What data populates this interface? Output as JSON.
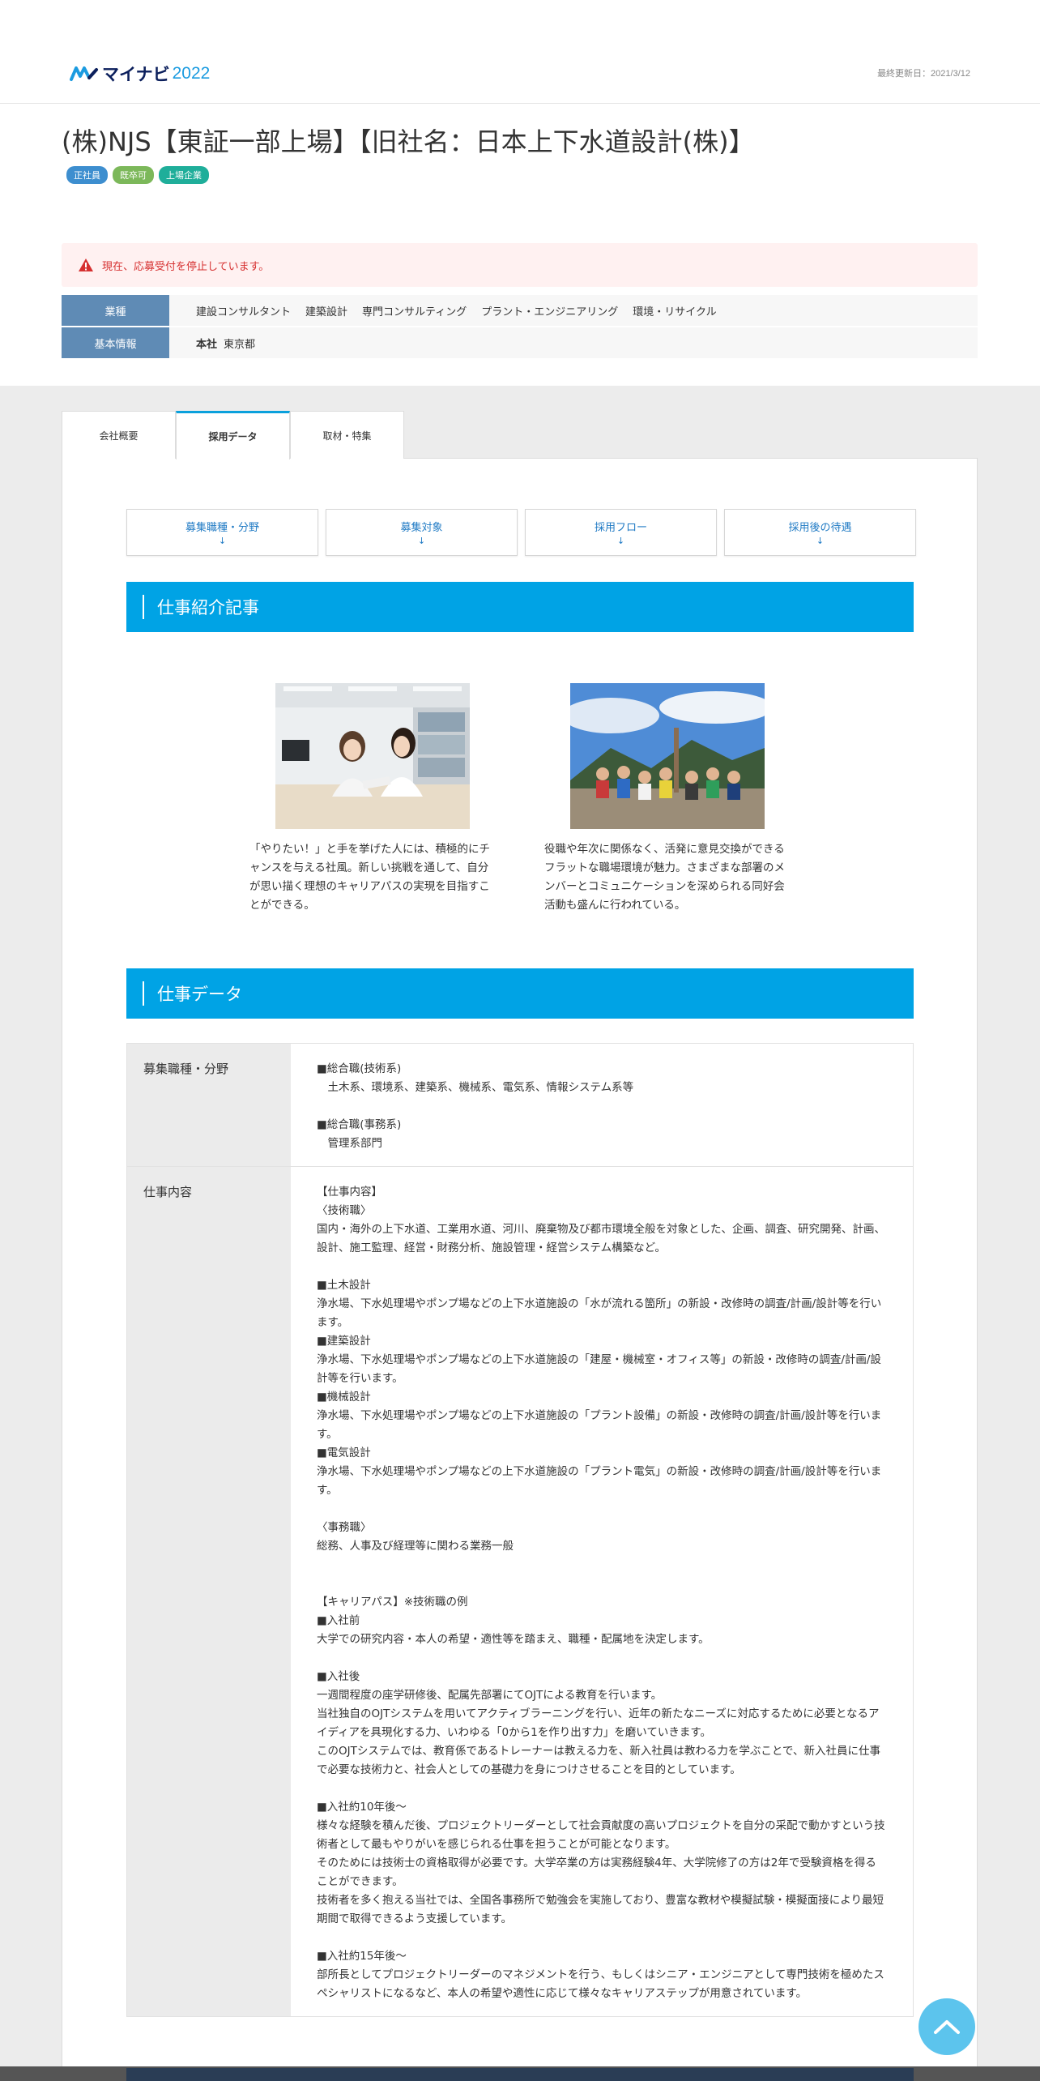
{
  "header": {
    "logo_text": "マイナビ",
    "logo_year": "2022",
    "updated": "最終更新日：2021/3/12"
  },
  "company": {
    "name": "(株)NJS【東証一部上場】【旧社名：日本上下水道設計(株)】",
    "tags": [
      {
        "label": "正社員",
        "color": "#3d8ecf"
      },
      {
        "label": "既卒可",
        "color": "#7cb85a"
      },
      {
        "label": "上場企業",
        "color": "#1fae9a"
      }
    ]
  },
  "notice": {
    "text": "現在、応募受付を停止しています。"
  },
  "info": {
    "industry_label": "業種",
    "industries": [
      "建設コンサルタント",
      "建築設計",
      "専門コンサルティング",
      "プラント・エンジニアリング",
      "環境・リサイクル"
    ],
    "basic_label": "基本情報",
    "hq_label": "本社",
    "hq_value": "東京都"
  },
  "tabs": [
    {
      "label": "会社概要"
    },
    {
      "label": "採用データ"
    },
    {
      "label": "取材・特集"
    }
  ],
  "jump_links": [
    {
      "label": "募集職種・分野",
      "arrow": "↓"
    },
    {
      "label": "募集対象",
      "arrow": "↓"
    },
    {
      "label": "採用フロー",
      "arrow": "↓"
    },
    {
      "label": "採用後の待遇",
      "arrow": "↓"
    }
  ],
  "sections": {
    "articles_title": "仕事紹介記事",
    "jobdata_title": "仕事データ"
  },
  "articles": [
    {
      "caption": "「やりたい！」と手を挙げた人には、積極的にチャンスを与える社風。新しい挑戦を通して、自分が思い描く理想のキャリアパスの実現を目指すことができる。"
    },
    {
      "caption": "役職や年次に関係なく、活発に意見交換ができるフラットな職場環境が魅力。さまざまな部署のメンバーとコミュニケーションを深められる同好会活動も盛んに行われている。"
    }
  ],
  "job_table": {
    "row1_head": "募集職種・分野",
    "row1_body": "■総合職(技術系)\n　土木系、環境系、建築系、機械系、電気系、情報システム系等\n\n■総合職(事務系)\n　管理系部門",
    "row2_head": "仕事内容",
    "row2_body": "【仕事内容】\n〈技術職〉\n国内・海外の上下水道、工業用水道、河川、廃棄物及び都市環境全般を対象とした、企画、調査、研究開発、計画、設計、施工監理、経営・財務分析、施設管理・経営システム構築など。\n\n■土木設計\n浄水場、下水処理場やポンプ場などの上下水道施設の「水が流れる箇所」の新設・改修時の調査/計画/設計等を行います。\n■建築設計\n浄水場、下水処理場やポンプ場などの上下水道施設の「建屋・機械室・オフィス等」の新設・改修時の調査/計画/設計等を行います。\n■機械設計\n浄水場、下水処理場やポンプ場などの上下水道施設の「プラント設備」の新設・改修時の調査/計画/設計等を行います。\n■電気設計\n浄水場、下水処理場やポンプ場などの上下水道施設の「プラント電気」の新設・改修時の調査/計画/設計等を行います。\n\n〈事務職〉\n総務、人事及び経理等に関わる業務一般\n\n\n【キャリアパス】※技術職の例\n■入社前\n大学での研究内容・本人の希望・適性等を踏まえ、職種・配属地を決定します。\n\n■入社後\n一週間程度の座学研修後、配属先部署にてOJTによる教育を行います。\n当社独自のOJTシステムを用いてアクティブラーニングを行い、近年の新たなニーズに対応するために必要となるアイディアを具現化する力、いわゆる「0から1を作り出す力」を磨いていきます。\nこのOJTシステムでは、教育係であるトレーナーは教える力を、新入社員は教わる力を学ぶことで、新入社員に仕事で必要な技術力と、社会人としての基礎力を身につけさせることを目的としています。\n\n■入社約10年後～\n様々な経験を積んだ後、プロジェクトリーダーとして社会貢献度の高いプロジェクトを自分の采配で動かすという技術者として最もやりがいを感じられる仕事を担うことが可能となります。\nそのためには技術士の資格取得が必要です。大学卒業の方は実務経験4年、大学院修了の方は2年で受験資格を得ることができます。\n技術者を多く抱える当社では、全国各事務所で勉強会を実施しており、豊富な教材や模擬試験・模擬面接により最短期間で取得できるよう支援しています。\n\n■入社約15年後～\n部所長としてプロジェクトリーダーのマネジメントを行う、もしくはシニア・エンジニアとして専門技術を極めたスペシャリストになるなど、本人の希望や適性に応じて様々なキャリアステップが用意されています。"
  },
  "icons": {
    "warning": "warning-icon",
    "to_top": "chevron-up-icon"
  }
}
